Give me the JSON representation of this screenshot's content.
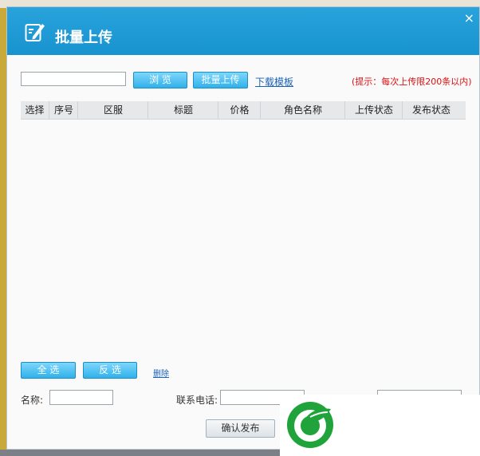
{
  "dialog": {
    "title": "批量上传",
    "close_symbol": "×"
  },
  "toolbar": {
    "file_value": "",
    "browse_label": "浏 览",
    "batch_upload_label": "批量上传",
    "download_template_label": "下载模板",
    "hint": "(提示：每次上传限200条以内)"
  },
  "table": {
    "columns": [
      "选择",
      "序号",
      "区服",
      "标题",
      "价格",
      "角色名称",
      "上传状态",
      "发布状态"
    ]
  },
  "actions": {
    "select_all_label": "全 选",
    "invert_label": "反 选",
    "delete_label": "删除"
  },
  "form": {
    "name_label": "名称:",
    "name_value": "",
    "phone_label": "联系电话:",
    "phone_value": "",
    "extra_value": "",
    "confirm_label": "确认发布"
  },
  "colors": {
    "titlebar": "#1793cf",
    "button": "#2fb1ea",
    "hint": "#dd1111",
    "link": "#1a63b7"
  },
  "icons": {
    "title_icon": "edit-icon",
    "watermark_logo": "leaf-logo"
  }
}
